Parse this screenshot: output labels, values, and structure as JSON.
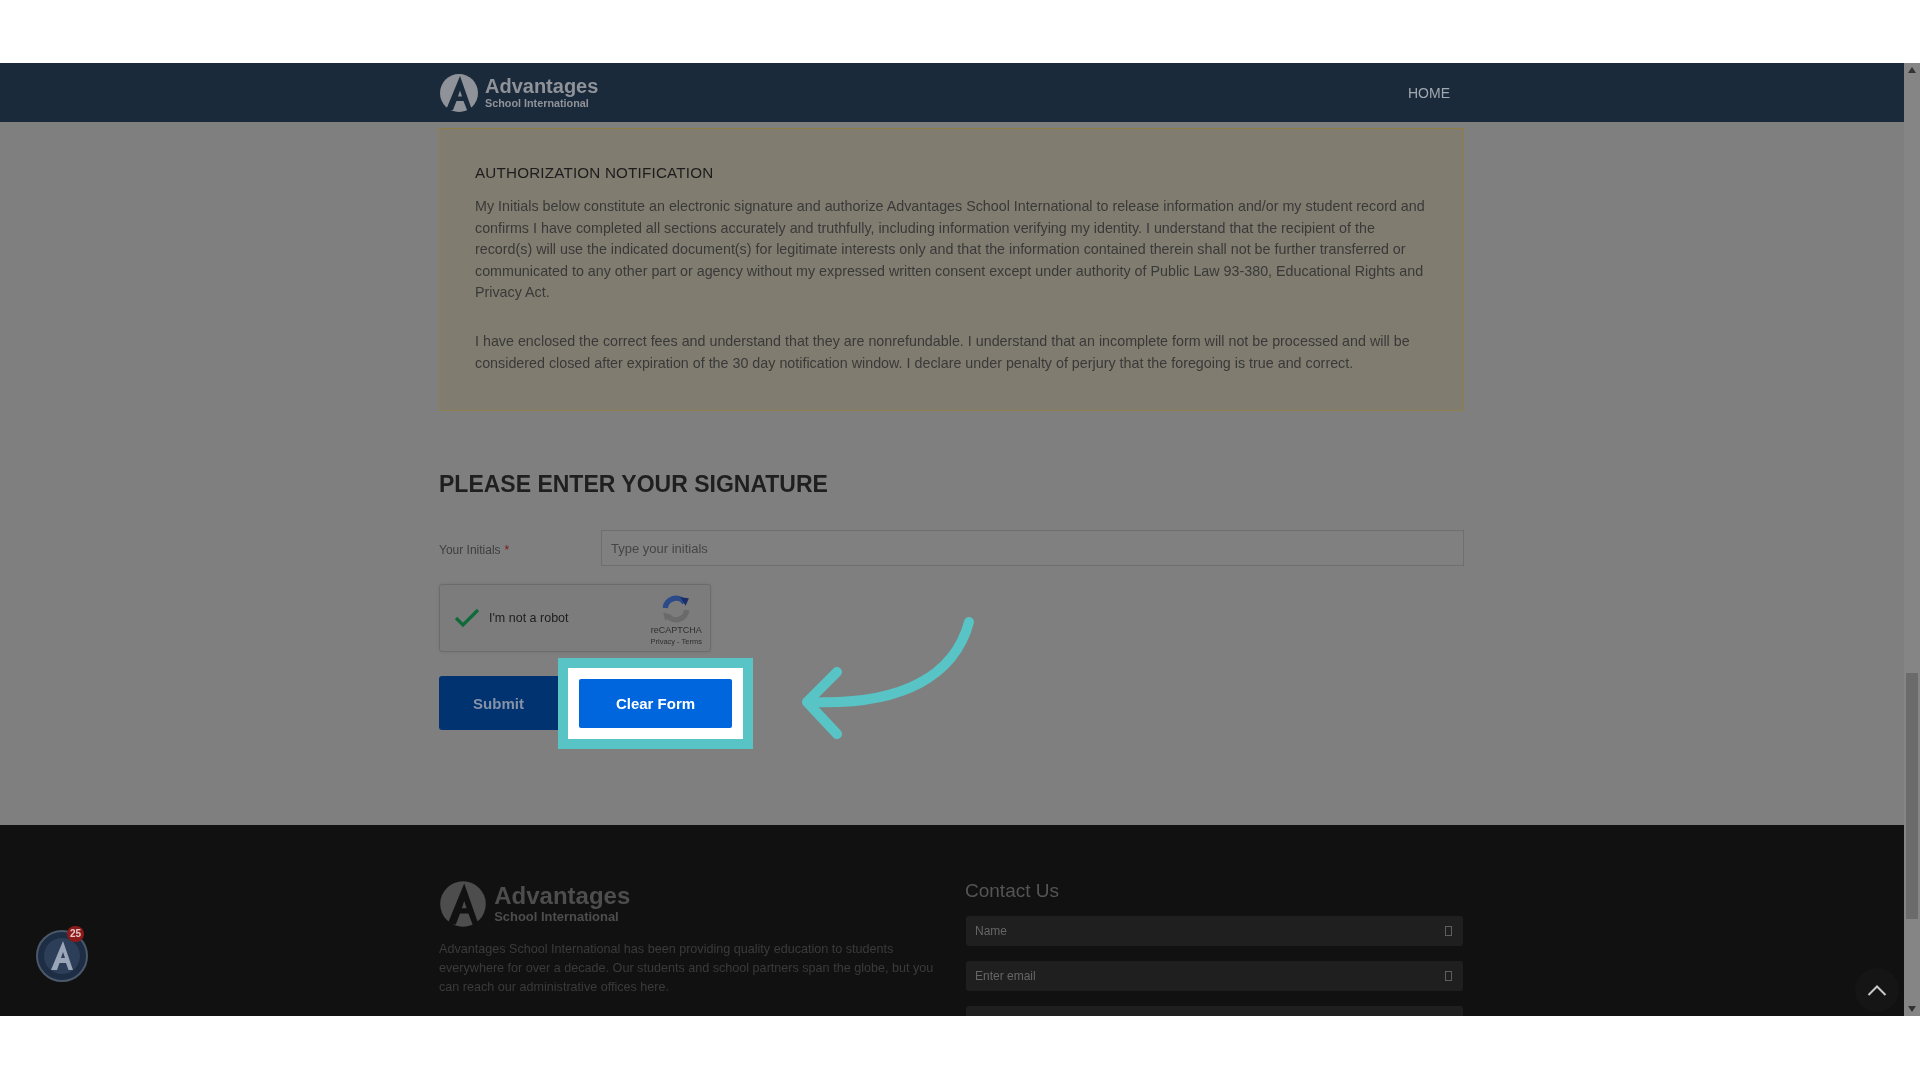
{
  "navbar": {
    "logo": {
      "name": "Advantages",
      "tagline": "School International"
    },
    "links": [
      "HOME"
    ]
  },
  "authorization": {
    "title": "AUTHORIZATION NOTIFICATION",
    "paragraphs": [
      "My Initials below constitute an electronic signature and authorize Advantages School International to release information and/or my student record and confirms I have completed all sections accurately and truthfully, including information verifying my identity. I understand that the recipient of the record(s) will use the indicated document(s) for legitimate interests only and that the information contained therein shall not be further transferred or communicated to any other part or agency without my expressed written consent except under authority of Public Law 93-380, Educational Rights and Privacy Act.",
      "I have enclosed the correct fees and understand that they are nonrefundable. I understand that an incomplete form will not be processed and will be considered closed after expiration of the 30 day notification window. I declare under penalty of perjury that the foregoing is true and correct."
    ]
  },
  "signature": {
    "heading": "PLEASE ENTER YOUR SIGNATURE",
    "initials": {
      "label": "Your Initials",
      "required_mark": "*",
      "placeholder": "Type your initials"
    },
    "captcha": {
      "label": "I'm not a robot",
      "checked": true,
      "brand": "reCAPTCHA",
      "links": [
        "Privacy",
        "Terms"
      ],
      "separator": "-"
    },
    "buttons": [
      {
        "label": "Submit",
        "highlighted": false
      },
      {
        "label": "Clear Form",
        "highlighted": true
      }
    ]
  },
  "footer": {
    "logo": {
      "name": "Advantages",
      "tagline": "School International"
    },
    "about": "Advantages School International has been providing quality education to students everywhere for over a decade. Our students and school partners span the globe, but you can reach our administrative offices here.",
    "contact": {
      "title": "Contact Us",
      "fields": [
        {
          "kind": "input",
          "placeholder": "Name"
        },
        {
          "kind": "input",
          "placeholder": "Enter email"
        },
        {
          "kind": "textarea"
        }
      ]
    }
  },
  "widget_badge": {
    "count": "25"
  }
}
